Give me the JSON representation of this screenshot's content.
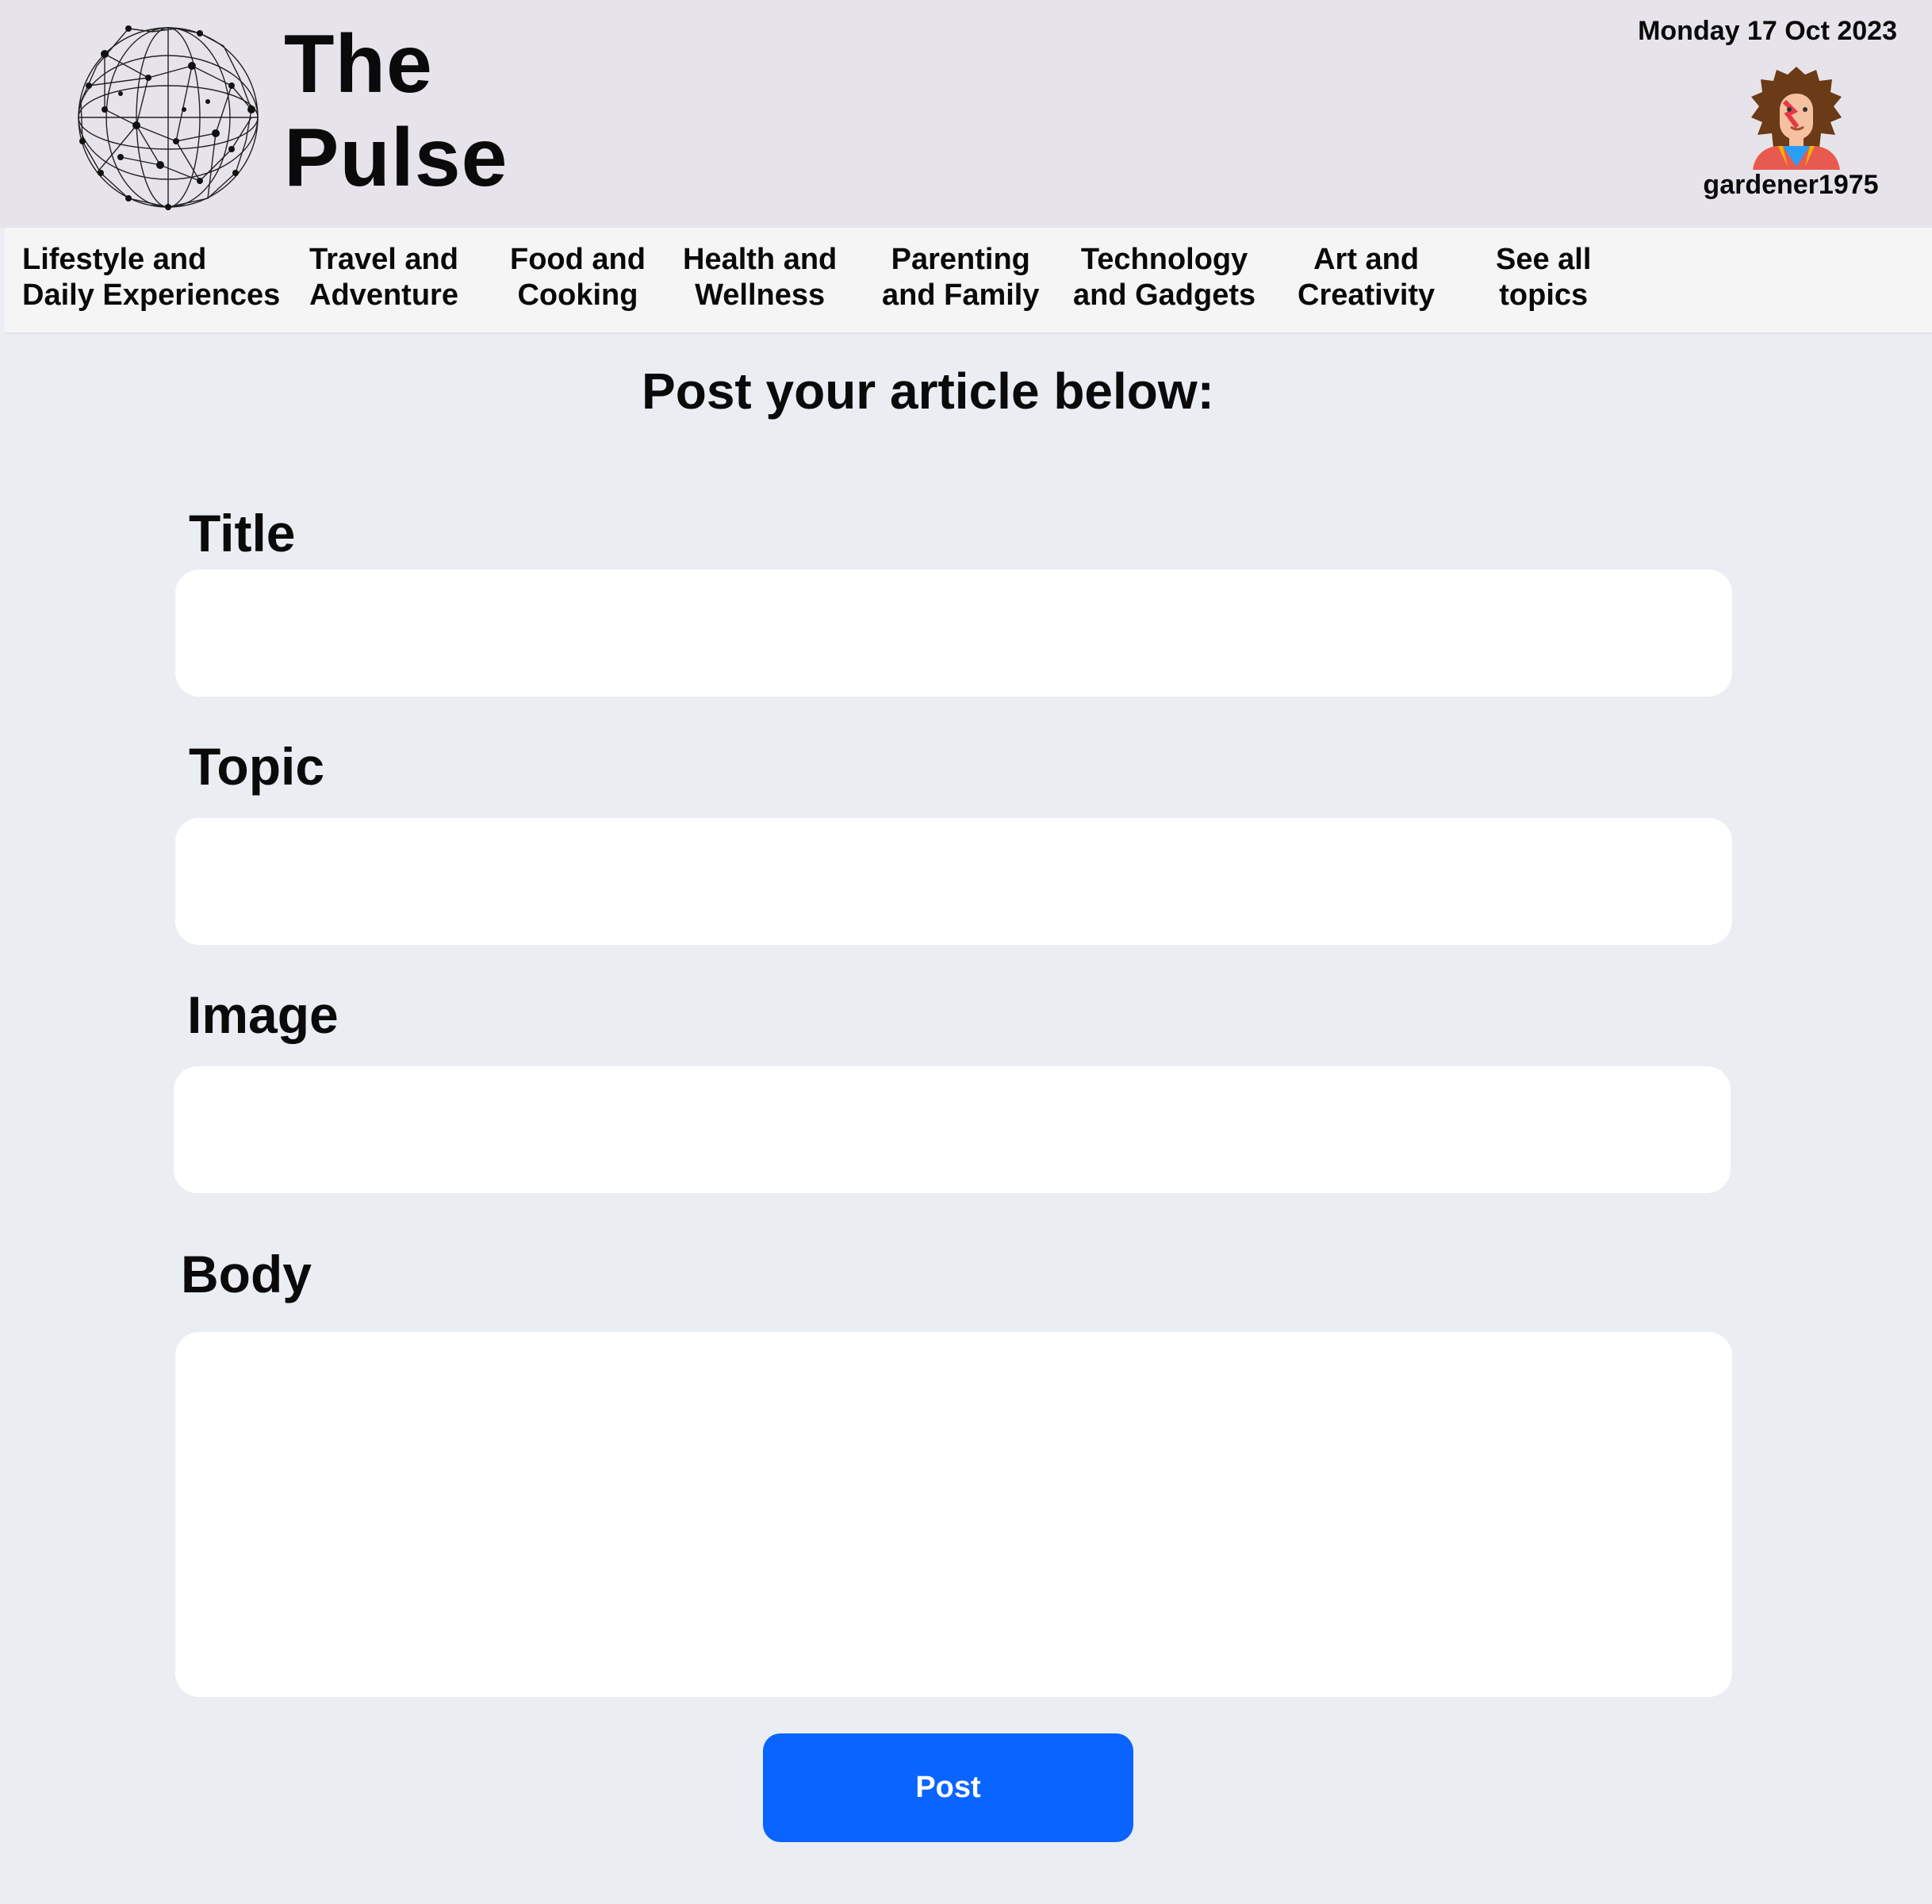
{
  "header": {
    "brand_line1": "The",
    "brand_line2": "Pulse",
    "date": "Monday 17 Oct 2023",
    "username": "gardener1975",
    "logo_icon": "network-globe-icon",
    "avatar_icon": "user-avatar-icon"
  },
  "nav": {
    "items": [
      {
        "line1": "Lifestyle and",
        "line2": "Daily Experiences"
      },
      {
        "line1": "Travel and",
        "line2": "Adventure"
      },
      {
        "line1": "Food and",
        "line2": "Cooking"
      },
      {
        "line1": "Health and",
        "line2": "Wellness"
      },
      {
        "line1": "Parenting",
        "line2": "and Family"
      },
      {
        "line1": "Technology",
        "line2": "and Gadgets"
      },
      {
        "line1": "Art and",
        "line2": "Creativity"
      },
      {
        "line1": "See all",
        "line2": "topics"
      }
    ]
  },
  "form": {
    "heading": "Post your article below:",
    "title_label": "Title",
    "title_value": "",
    "topic_label": "Topic",
    "topic_value": "",
    "image_label": "Image",
    "image_value": "",
    "body_label": "Body",
    "body_value": "",
    "submit_label": "Post"
  },
  "colors": {
    "header_bg": "#e7e3ea",
    "nav_bg": "#f5f5f5",
    "page_bg": "#eaedf2",
    "button_bg": "#0a64ff"
  }
}
